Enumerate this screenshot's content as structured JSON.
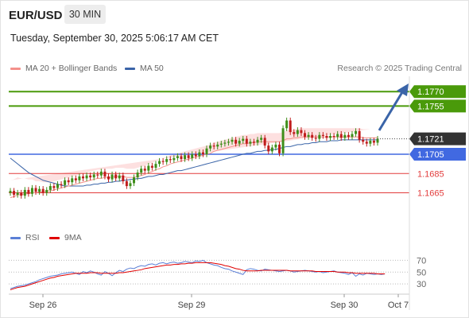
{
  "header": {
    "symbol": "EUR/USD",
    "timeframe": "30 MIN"
  },
  "datetime": "Tuesday, September 30, 2025 5:06:17 AM CET",
  "legend": {
    "ma20": {
      "label": "MA 20 + Bollinger Bands",
      "color": "#f4908b"
    },
    "ma50": {
      "label": "MA 50",
      "color": "#3a64a8"
    },
    "rsi": {
      "label": "RSI",
      "color": "#5b7fd6"
    },
    "rsi_ma": {
      "label": "9MA",
      "color": "#e00000"
    }
  },
  "credit": "Research © 2025 Trading Central",
  "chart_data": {
    "type": "line",
    "price_ylim": [
      1.163,
      1.1785
    ],
    "x_ticks": [
      "Sep 26",
      "Sep 29",
      "Sep 30",
      "Oct 7"
    ],
    "current_price": {
      "label": "1.1721",
      "value": 1.1721
    },
    "levels": [
      {
        "label": "1.1770",
        "value": 1.177,
        "kind": "target"
      },
      {
        "label": "1.1755",
        "value": 1.1755,
        "kind": "target"
      },
      {
        "label": "1.1705",
        "value": 1.1705,
        "kind": "pivot"
      },
      {
        "label": "1.1685",
        "value": 1.1685,
        "kind": "support"
      },
      {
        "label": "1.1665",
        "value": 1.1665,
        "kind": "support"
      }
    ],
    "colors": {
      "target": "#4a9a0a",
      "pivot": "#4169e1",
      "support": "#e23c3c",
      "up": "#3e8e1a",
      "down": "#c01d1d",
      "band_fill": "#fde0e0",
      "current": "#333333"
    },
    "price_close": [
      1.1667,
      1.1663,
      1.1665,
      1.1662,
      1.1668,
      1.1664,
      1.167,
      1.1666,
      1.1669,
      1.1665,
      1.1668,
      1.1672,
      1.167,
      1.1674,
      1.1673,
      1.1678,
      1.1676,
      1.168,
      1.1678,
      1.1682,
      1.168,
      1.1683,
      1.1681,
      1.1684,
      1.1683,
      1.1687,
      1.1682,
      1.1679,
      1.1684,
      1.168,
      1.1683,
      1.1677,
      1.1672,
      1.1675,
      1.1681,
      1.1686,
      1.169,
      1.1688,
      1.1693,
      1.1691,
      1.1695,
      1.1698,
      1.1697,
      1.17,
      1.1699,
      1.1701,
      1.1703,
      1.17,
      1.1704,
      1.1701,
      1.1705,
      1.1703,
      1.1707,
      1.1705,
      1.1711,
      1.1714,
      1.1713,
      1.1715,
      1.1716,
      1.1717,
      1.1718,
      1.172,
      1.1716,
      1.1719,
      1.1721,
      1.1716,
      1.1718,
      1.1717,
      1.172,
      1.1722,
      1.1714,
      1.1708,
      1.1712,
      1.1715,
      1.1706,
      1.1732,
      1.174,
      1.1728,
      1.1726,
      1.173,
      1.1727,
      1.1723,
      1.1725,
      1.1722,
      1.1721,
      1.1725,
      1.1724,
      1.1722,
      1.1724,
      1.1723,
      1.1726,
      1.1722,
      1.1725,
      1.1723,
      1.1726,
      1.1729,
      1.172,
      1.1718,
      1.1716,
      1.1719,
      1.1717,
      1.1721
    ],
    "ma20": [
      1.166,
      1.1661,
      1.1663,
      1.1663,
      1.1664,
      1.1664,
      1.1665,
      1.1665,
      1.1666,
      1.1666,
      1.1667,
      1.1667,
      1.1668,
      1.1669,
      1.167,
      1.1671,
      1.1672,
      1.1673,
      1.1674,
      1.1675,
      1.1676,
      1.1677,
      1.1678,
      1.1679,
      1.168,
      1.168,
      1.1681,
      1.1681,
      1.1681,
      1.1682,
      1.1682,
      1.1682,
      1.1681,
      1.1681,
      1.1681,
      1.1682,
      1.1683,
      1.1684,
      1.1686,
      1.1687,
      1.1689,
      1.169,
      1.1692,
      1.1693,
      1.1695,
      1.1696,
      1.1697,
      1.1698,
      1.1699,
      1.17,
      1.1701,
      1.1702,
      1.1703,
      1.1704,
      1.1705,
      1.1706,
      1.1708,
      1.1709,
      1.171,
      1.1711,
      1.1712,
      1.1713,
      1.1714,
      1.1715,
      1.1716,
      1.1716,
      1.1717,
      1.1717,
      1.1718,
      1.1718,
      1.1718,
      1.1718,
      1.1718,
      1.1718,
      1.1718,
      1.1719,
      1.1721,
      1.1721,
      1.1722,
      1.1722,
      1.1723,
      1.1723,
      1.1723,
      1.1723,
      1.1723,
      1.1723,
      1.1723,
      1.1723,
      1.1723,
      1.1723,
      1.1723,
      1.1723,
      1.1723,
      1.1723,
      1.1723,
      1.1723,
      1.1723,
      1.1722,
      1.1722,
      1.1722,
      1.1722,
      1.1722
    ],
    "ma50": [
      1.1701,
      1.1698,
      1.1695,
      1.1692,
      1.1689,
      1.1686,
      1.1684,
      1.1682,
      1.168,
      1.1678,
      1.1677,
      1.1676,
      1.1675,
      1.1674,
      1.1673,
      1.1672,
      1.1672,
      1.1672,
      1.1672,
      1.1672,
      1.1672,
      1.1673,
      1.1673,
      1.1674,
      1.1674,
      1.1675,
      1.1675,
      1.1676,
      1.1676,
      1.1677,
      1.1677,
      1.1678,
      1.1678,
      1.1679,
      1.1679,
      1.168,
      1.168,
      1.1681,
      1.1682,
      1.1682,
      1.1683,
      1.1684,
      1.1684,
      1.1685,
      1.1686,
      1.1687,
      1.1688,
      1.1688,
      1.1689,
      1.169,
      1.1691,
      1.1692,
      1.1693,
      1.1694,
      1.1695,
      1.1696,
      1.1697,
      1.1698,
      1.1699,
      1.17,
      1.1701,
      1.1702,
      1.1703,
      1.1704,
      1.1705,
      1.1706,
      1.1706,
      1.1707,
      1.1708,
      1.1708,
      1.1709,
      1.1709,
      1.171,
      1.171,
      1.1711,
      1.1712,
      1.1713,
      1.1713,
      1.1714,
      1.1715,
      1.1715,
      1.1716,
      1.1716,
      1.1717,
      1.1717,
      1.1718,
      1.1718,
      1.1718,
      1.1719,
      1.1719,
      1.1719,
      1.172,
      1.172,
      1.172,
      1.172,
      1.172,
      1.172,
      1.172,
      1.172,
      1.172,
      1.172,
      1.172
    ],
    "bb_width": [
      18,
      18,
      18,
      17,
      16,
      15,
      14,
      12,
      11,
      10,
      9,
      9,
      9,
      9,
      9,
      9,
      9,
      9,
      9,
      9,
      9,
      9,
      9,
      9,
      9,
      9,
      9,
      9,
      9,
      9,
      9,
      9,
      9,
      9,
      9,
      9,
      9,
      9,
      9,
      9,
      9,
      9,
      9,
      9,
      9,
      9,
      9,
      9,
      9,
      9,
      9,
      9,
      9,
      9,
      9,
      9,
      9,
      9,
      9,
      9,
      9,
      9,
      9,
      9,
      9,
      9,
      9,
      9,
      9,
      9,
      9,
      9,
      9,
      9,
      9,
      9,
      9,
      9,
      9,
      9,
      9,
      9,
      9,
      9,
      9,
      9,
      9,
      9,
      9,
      9,
      9,
      9,
      9,
      9,
      9,
      9,
      9,
      9,
      9,
      9
    ],
    "rsi_ticks": [
      70,
      50,
      30
    ],
    "rsi_ylim": [
      10,
      80
    ],
    "rsi": [
      22,
      24,
      26,
      27,
      28,
      30,
      32,
      34,
      37,
      39,
      41,
      43,
      44,
      45,
      47,
      48,
      49,
      50,
      48,
      46,
      51,
      49,
      52,
      50,
      47,
      45,
      51,
      48,
      44,
      49,
      53,
      51,
      55,
      57,
      56,
      59,
      61,
      60,
      63,
      64,
      62,
      65,
      66,
      64,
      66,
      67,
      65,
      66,
      68,
      67,
      66,
      69,
      68,
      70,
      66,
      64,
      62,
      61,
      58,
      56,
      55,
      52,
      50,
      48,
      46,
      54,
      56,
      55,
      53,
      52,
      55,
      54,
      53,
      52,
      51,
      52,
      53,
      52,
      50,
      51,
      52,
      53,
      52,
      51,
      50,
      51,
      49,
      50,
      51,
      52,
      50,
      49,
      48,
      46,
      49,
      43,
      47,
      45,
      48,
      47,
      46,
      47,
      46,
      47
    ],
    "rsi_ma": [
      20,
      22,
      24,
      25,
      26,
      28,
      30,
      32,
      34,
      36,
      38,
      40,
      41,
      43,
      44,
      45,
      46,
      47,
      48,
      48,
      48,
      48,
      49,
      49,
      49,
      48,
      48,
      48,
      48,
      48,
      49,
      49,
      50,
      51,
      52,
      53,
      54,
      56,
      57,
      58,
      59,
      60,
      61,
      62,
      62,
      63,
      63,
      64,
      64,
      65,
      65,
      66,
      66,
      66,
      66,
      66,
      65,
      64,
      63,
      61,
      60,
      58,
      56,
      55,
      53,
      52,
      52,
      52,
      52,
      53,
      53,
      53,
      53,
      53,
      53,
      53,
      53,
      52,
      52,
      52,
      52,
      52,
      52,
      52,
      51,
      51,
      51,
      51,
      51,
      51,
      50,
      50,
      50,
      49,
      49,
      48,
      48,
      48,
      48,
      48,
      48,
      47,
      47,
      47
    ]
  }
}
